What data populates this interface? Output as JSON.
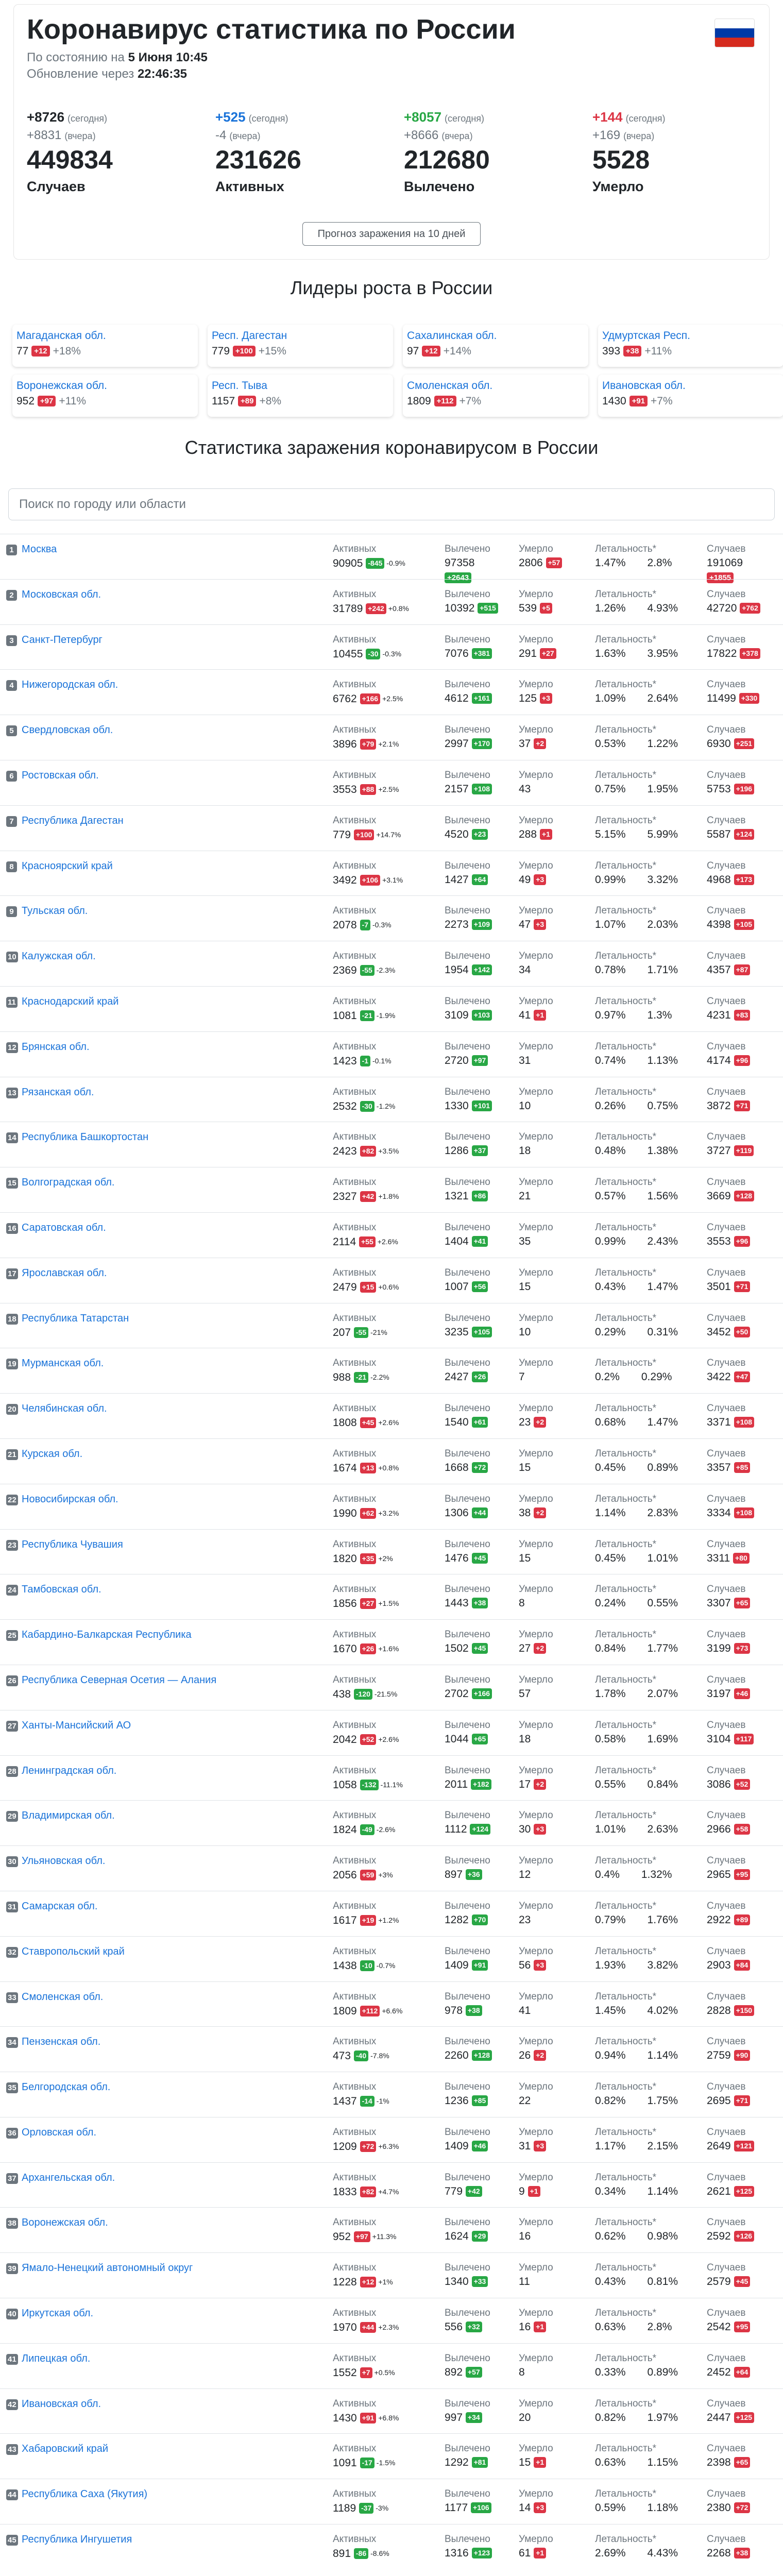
{
  "header": {
    "title": "Коронавирус статистика по России",
    "as_of_prefix": "По состоянию на",
    "as_of_value": "5 Июня 10:45",
    "update_prefix": "Обновление через",
    "update_value": "22:46:35",
    "forecast_button": "Прогноз заражения на 10 дней"
  },
  "colors": {
    "accent_blue": "#1a73d9",
    "red": "#dc3545",
    "green": "#28a745"
  },
  "summary": [
    {
      "today": "+8726",
      "today_note": "(сегодня)",
      "yesterday": "+8831",
      "yesterday_note": "(вчера)",
      "total": "449834",
      "label": "Случаев",
      "color": "#212529"
    },
    {
      "today": "+525",
      "today_note": "(сегодня)",
      "yesterday": "-4",
      "yesterday_note": "(вчера)",
      "total": "231626",
      "label": "Активных",
      "color": "#1a73d9"
    },
    {
      "today": "+8057",
      "today_note": "(сегодня)",
      "yesterday": "+8666",
      "yesterday_note": "(вчера)",
      "total": "212680",
      "label": "Вылечено",
      "color": "#28a745"
    },
    {
      "today": "+144",
      "today_note": "(сегодня)",
      "yesterday": "+169",
      "yesterday_note": "(вчера)",
      "total": "5528",
      "label": "Умерло",
      "color": "#dc3545"
    }
  ],
  "leaders_title": "Лидеры роста в России",
  "leaders": [
    {
      "name": "Магаданская обл.",
      "total": "77",
      "delta": "+12",
      "pct": "+18%"
    },
    {
      "name": "Респ. Дагестан",
      "total": "779",
      "delta": "+100",
      "pct": "+15%"
    },
    {
      "name": "Сахалинская обл.",
      "total": "97",
      "delta": "+12",
      "pct": "+14%"
    },
    {
      "name": "Удмуртская Респ.",
      "total": "393",
      "delta": "+38",
      "pct": "+11%"
    },
    {
      "name": "Воронежская обл.",
      "total": "952",
      "delta": "+97",
      "pct": "+11%"
    },
    {
      "name": "Респ. Тыва",
      "total": "1157",
      "delta": "+89",
      "pct": "+8%"
    },
    {
      "name": "Смоленская обл.",
      "total": "1809",
      "delta": "+112",
      "pct": "+7%"
    },
    {
      "name": "Ивановская обл.",
      "total": "1430",
      "delta": "+91",
      "pct": "+7%"
    }
  ],
  "stats_title": "Статистика заражения коронавирусом в России",
  "search": {
    "placeholder": "Поиск по городу или области"
  },
  "col_labels": {
    "active": "Активных",
    "recovered": "Вылечено",
    "died": "Умерло",
    "lethality": "Летальность*",
    "cases": "Случаев"
  },
  "regions": [
    {
      "n": "1",
      "name": "Москва",
      "act": "90905",
      "act_d": "-845",
      "act_p": "-0.9%",
      "rec": "97358",
      "rec_d": "+2643",
      "dea": "2806",
      "dea_d": "+57",
      "l1": "1.47%",
      "l2": "2.8%",
      "cas": "191069",
      "cas_d": "+1855"
    },
    {
      "n": "2",
      "name": "Московская обл.",
      "act": "31789",
      "act_d": "+242",
      "act_p": "+0.8%",
      "rec": "10392",
      "rec_d": "+515",
      "dea": "539",
      "dea_d": "+5",
      "l1": "1.26%",
      "l2": "4.93%",
      "cas": "42720",
      "cas_d": "+762"
    },
    {
      "n": "3",
      "name": "Санкт-Петербург",
      "act": "10455",
      "act_d": "-30",
      "act_p": "-0.3%",
      "rec": "7076",
      "rec_d": "+381",
      "dea": "291",
      "dea_d": "+27",
      "l1": "1.63%",
      "l2": "3.95%",
      "cas": "17822",
      "cas_d": "+378"
    },
    {
      "n": "4",
      "name": "Нижегородская обл.",
      "act": "6762",
      "act_d": "+166",
      "act_p": "+2.5%",
      "rec": "4612",
      "rec_d": "+161",
      "dea": "125",
      "dea_d": "+3",
      "l1": "1.09%",
      "l2": "2.64%",
      "cas": "11499",
      "cas_d": "+330"
    },
    {
      "n": "5",
      "name": "Свердловская обл.",
      "act": "3896",
      "act_d": "+79",
      "act_p": "+2.1%",
      "rec": "2997",
      "rec_d": "+170",
      "dea": "37",
      "dea_d": "+2",
      "l1": "0.53%",
      "l2": "1.22%",
      "cas": "6930",
      "cas_d": "+251"
    },
    {
      "n": "6",
      "name": "Ростовская обл.",
      "act": "3553",
      "act_d": "+88",
      "act_p": "+2.5%",
      "rec": "2157",
      "rec_d": "+108",
      "dea": "43",
      "dea_d": "",
      "l1": "0.75%",
      "l2": "1.95%",
      "cas": "5753",
      "cas_d": "+196"
    },
    {
      "n": "7",
      "name": "Республика Дагестан",
      "act": "779",
      "act_d": "+100",
      "act_p": "+14.7%",
      "rec": "4520",
      "rec_d": "+23",
      "dea": "288",
      "dea_d": "+1",
      "l1": "5.15%",
      "l2": "5.99%",
      "cas": "5587",
      "cas_d": "+124"
    },
    {
      "n": "8",
      "name": "Красноярский край",
      "act": "3492",
      "act_d": "+106",
      "act_p": "+3.1%",
      "rec": "1427",
      "rec_d": "+64",
      "dea": "49",
      "dea_d": "+3",
      "l1": "0.99%",
      "l2": "3.32%",
      "cas": "4968",
      "cas_d": "+173"
    },
    {
      "n": "9",
      "name": "Тульская обл.",
      "act": "2078",
      "act_d": "-7",
      "act_p": "-0.3%",
      "rec": "2273",
      "rec_d": "+109",
      "dea": "47",
      "dea_d": "+3",
      "l1": "1.07%",
      "l2": "2.03%",
      "cas": "4398",
      "cas_d": "+105"
    },
    {
      "n": "10",
      "name": "Калужская обл.",
      "act": "2369",
      "act_d": "-55",
      "act_p": "-2.3%",
      "rec": "1954",
      "rec_d": "+142",
      "dea": "34",
      "dea_d": "",
      "l1": "0.78%",
      "l2": "1.71%",
      "cas": "4357",
      "cas_d": "+87"
    },
    {
      "n": "11",
      "name": "Краснодарский край",
      "act": "1081",
      "act_d": "-21",
      "act_p": "-1.9%",
      "rec": "3109",
      "rec_d": "+103",
      "dea": "41",
      "dea_d": "+1",
      "l1": "0.97%",
      "l2": "1.3%",
      "cas": "4231",
      "cas_d": "+83"
    },
    {
      "n": "12",
      "name": "Брянская обл.",
      "act": "1423",
      "act_d": "-1",
      "act_p": "-0.1%",
      "rec": "2720",
      "rec_d": "+97",
      "dea": "31",
      "dea_d": "",
      "l1": "0.74%",
      "l2": "1.13%",
      "cas": "4174",
      "cas_d": "+96"
    },
    {
      "n": "13",
      "name": "Рязанская обл.",
      "act": "2532",
      "act_d": "-30",
      "act_p": "-1.2%",
      "rec": "1330",
      "rec_d": "+101",
      "dea": "10",
      "dea_d": "",
      "l1": "0.26%",
      "l2": "0.75%",
      "cas": "3872",
      "cas_d": "+71"
    },
    {
      "n": "14",
      "name": "Республика Башкортостан",
      "act": "2423",
      "act_d": "+82",
      "act_p": "+3.5%",
      "rec": "1286",
      "rec_d": "+37",
      "dea": "18",
      "dea_d": "",
      "l1": "0.48%",
      "l2": "1.38%",
      "cas": "3727",
      "cas_d": "+119"
    },
    {
      "n": "15",
      "name": "Волгоградская обл.",
      "act": "2327",
      "act_d": "+42",
      "act_p": "+1.8%",
      "rec": "1321",
      "rec_d": "+86",
      "dea": "21",
      "dea_d": "",
      "l1": "0.57%",
      "l2": "1.56%",
      "cas": "3669",
      "cas_d": "+128"
    },
    {
      "n": "16",
      "name": "Саратовская обл.",
      "act": "2114",
      "act_d": "+55",
      "act_p": "+2.6%",
      "rec": "1404",
      "rec_d": "+41",
      "dea": "35",
      "dea_d": "",
      "l1": "0.99%",
      "l2": "2.43%",
      "cas": "3553",
      "cas_d": "+96"
    },
    {
      "n": "17",
      "name": "Ярославская обл.",
      "act": "2479",
      "act_d": "+15",
      "act_p": "+0.6%",
      "rec": "1007",
      "rec_d": "+56",
      "dea": "15",
      "dea_d": "",
      "l1": "0.43%",
      "l2": "1.47%",
      "cas": "3501",
      "cas_d": "+71"
    },
    {
      "n": "18",
      "name": "Республика Татарстан",
      "act": "207",
      "act_d": "-55",
      "act_p": "-21%",
      "rec": "3235",
      "rec_d": "+105",
      "dea": "10",
      "dea_d": "",
      "l1": "0.29%",
      "l2": "0.31%",
      "cas": "3452",
      "cas_d": "+50"
    },
    {
      "n": "19",
      "name": "Мурманская обл.",
      "act": "988",
      "act_d": "-21",
      "act_p": "-2.2%",
      "rec": "2427",
      "rec_d": "+26",
      "dea": "7",
      "dea_d": "",
      "l1": "0.2%",
      "l2": "0.29%",
      "cas": "3422",
      "cas_d": "+47"
    },
    {
      "n": "20",
      "name": "Челябинская обл.",
      "act": "1808",
      "act_d": "+45",
      "act_p": "+2.6%",
      "rec": "1540",
      "rec_d": "+61",
      "dea": "23",
      "dea_d": "+2",
      "l1": "0.68%",
      "l2": "1.47%",
      "cas": "3371",
      "cas_d": "+108"
    },
    {
      "n": "21",
      "name": "Курская обл.",
      "act": "1674",
      "act_d": "+13",
      "act_p": "+0.8%",
      "rec": "1668",
      "rec_d": "+72",
      "dea": "15",
      "dea_d": "",
      "l1": "0.45%",
      "l2": "0.89%",
      "cas": "3357",
      "cas_d": "+85"
    },
    {
      "n": "22",
      "name": "Новосибирская обл.",
      "act": "1990",
      "act_d": "+62",
      "act_p": "+3.2%",
      "rec": "1306",
      "rec_d": "+44",
      "dea": "38",
      "dea_d": "+2",
      "l1": "1.14%",
      "l2": "2.83%",
      "cas": "3334",
      "cas_d": "+108"
    },
    {
      "n": "23",
      "name": "Республика Чувашия",
      "act": "1820",
      "act_d": "+35",
      "act_p": "+2%",
      "rec": "1476",
      "rec_d": "+45",
      "dea": "15",
      "dea_d": "",
      "l1": "0.45%",
      "l2": "1.01%",
      "cas": "3311",
      "cas_d": "+80"
    },
    {
      "n": "24",
      "name": "Тамбовская обл.",
      "act": "1856",
      "act_d": "+27",
      "act_p": "+1.5%",
      "rec": "1443",
      "rec_d": "+38",
      "dea": "8",
      "dea_d": "",
      "l1": "0.24%",
      "l2": "0.55%",
      "cas": "3307",
      "cas_d": "+65"
    },
    {
      "n": "25",
      "name": "Кабардино-Балкарская Республика",
      "act": "1670",
      "act_d": "+26",
      "act_p": "+1.6%",
      "rec": "1502",
      "rec_d": "+45",
      "dea": "27",
      "dea_d": "+2",
      "l1": "0.84%",
      "l2": "1.77%",
      "cas": "3199",
      "cas_d": "+73"
    },
    {
      "n": "26",
      "name": "Республика Северная Осетия — Алания",
      "act": "438",
      "act_d": "-120",
      "act_p": "-21.5%",
      "rec": "2702",
      "rec_d": "+166",
      "dea": "57",
      "dea_d": "",
      "l1": "1.78%",
      "l2": "2.07%",
      "cas": "3197",
      "cas_d": "+46"
    },
    {
      "n": "27",
      "name": "Ханты-Мансийский АО",
      "act": "2042",
      "act_d": "+52",
      "act_p": "+2.6%",
      "rec": "1044",
      "rec_d": "+65",
      "dea": "18",
      "dea_d": "",
      "l1": "0.58%",
      "l2": "1.69%",
      "cas": "3104",
      "cas_d": "+117"
    },
    {
      "n": "28",
      "name": "Ленинградская обл.",
      "act": "1058",
      "act_d": "-132",
      "act_p": "-11.1%",
      "rec": "2011",
      "rec_d": "+182",
      "dea": "17",
      "dea_d": "+2",
      "l1": "0.55%",
      "l2": "0.84%",
      "cas": "3086",
      "cas_d": "+52"
    },
    {
      "n": "29",
      "name": "Владимирская обл.",
      "act": "1824",
      "act_d": "-49",
      "act_p": "-2.6%",
      "rec": "1112",
      "rec_d": "+124",
      "dea": "30",
      "dea_d": "+3",
      "l1": "1.01%",
      "l2": "2.63%",
      "cas": "2966",
      "cas_d": "+58"
    },
    {
      "n": "30",
      "name": "Ульяновская обл.",
      "act": "2056",
      "act_d": "+59",
      "act_p": "+3%",
      "rec": "897",
      "rec_d": "+36",
      "dea": "12",
      "dea_d": "",
      "l1": "0.4%",
      "l2": "1.32%",
      "cas": "2965",
      "cas_d": "+95"
    },
    {
      "n": "31",
      "name": "Самарская обл.",
      "act": "1617",
      "act_d": "+19",
      "act_p": "+1.2%",
      "rec": "1282",
      "rec_d": "+70",
      "dea": "23",
      "dea_d": "",
      "l1": "0.79%",
      "l2": "1.76%",
      "cas": "2922",
      "cas_d": "+89"
    },
    {
      "n": "32",
      "name": "Ставропольский край",
      "act": "1438",
      "act_d": "-10",
      "act_p": "-0.7%",
      "rec": "1409",
      "rec_d": "+91",
      "dea": "56",
      "dea_d": "+3",
      "l1": "1.93%",
      "l2": "3.82%",
      "cas": "2903",
      "cas_d": "+84"
    },
    {
      "n": "33",
      "name": "Смоленская обл.",
      "act": "1809",
      "act_d": "+112",
      "act_p": "+6.6%",
      "rec": "978",
      "rec_d": "+38",
      "dea": "41",
      "dea_d": "",
      "l1": "1.45%",
      "l2": "4.02%",
      "cas": "2828",
      "cas_d": "+150"
    },
    {
      "n": "34",
      "name": "Пензенская обл.",
      "act": "473",
      "act_d": "-40",
      "act_p": "-7.8%",
      "rec": "2260",
      "rec_d": "+128",
      "dea": "26",
      "dea_d": "+2",
      "l1": "0.94%",
      "l2": "1.14%",
      "cas": "2759",
      "cas_d": "+90"
    },
    {
      "n": "35",
      "name": "Белгородская обл.",
      "act": "1437",
      "act_d": "-14",
      "act_p": "-1%",
      "rec": "1236",
      "rec_d": "+85",
      "dea": "22",
      "dea_d": "",
      "l1": "0.82%",
      "l2": "1.75%",
      "cas": "2695",
      "cas_d": "+71"
    },
    {
      "n": "36",
      "name": "Орловская обл.",
      "act": "1209",
      "act_d": "+72",
      "act_p": "+6.3%",
      "rec": "1409",
      "rec_d": "+46",
      "dea": "31",
      "dea_d": "+3",
      "l1": "1.17%",
      "l2": "2.15%",
      "cas": "2649",
      "cas_d": "+121"
    },
    {
      "n": "37",
      "name": "Архангельская обл.",
      "act": "1833",
      "act_d": "+82",
      "act_p": "+4.7%",
      "rec": "779",
      "rec_d": "+42",
      "dea": "9",
      "dea_d": "+1",
      "l1": "0.34%",
      "l2": "1.14%",
      "cas": "2621",
      "cas_d": "+125"
    },
    {
      "n": "38",
      "name": "Воронежская обл.",
      "act": "952",
      "act_d": "+97",
      "act_p": "+11.3%",
      "rec": "1624",
      "rec_d": "+29",
      "dea": "16",
      "dea_d": "",
      "l1": "0.62%",
      "l2": "0.98%",
      "cas": "2592",
      "cas_d": "+126"
    },
    {
      "n": "39",
      "name": "Ямало-Ненецкий автономный округ",
      "act": "1228",
      "act_d": "+12",
      "act_p": "+1%",
      "rec": "1340",
      "rec_d": "+33",
      "dea": "11",
      "dea_d": "",
      "l1": "0.43%",
      "l2": "0.81%",
      "cas": "2579",
      "cas_d": "+45"
    },
    {
      "n": "40",
      "name": "Иркутская обл.",
      "act": "1970",
      "act_d": "+44",
      "act_p": "+2.3%",
      "rec": "556",
      "rec_d": "+32",
      "dea": "16",
      "dea_d": "+1",
      "l1": "0.63%",
      "l2": "2.8%",
      "cas": "2542",
      "cas_d": "+95"
    },
    {
      "n": "41",
      "name": "Липецкая обл.",
      "act": "1552",
      "act_d": "+7",
      "act_p": "+0.5%",
      "rec": "892",
      "rec_d": "+57",
      "dea": "8",
      "dea_d": "",
      "l1": "0.33%",
      "l2": "0.89%",
      "cas": "2452",
      "cas_d": "+64"
    },
    {
      "n": "42",
      "name": "Ивановская обл.",
      "act": "1430",
      "act_d": "+91",
      "act_p": "+6.8%",
      "rec": "997",
      "rec_d": "+34",
      "dea": "20",
      "dea_d": "",
      "l1": "0.82%",
      "l2": "1.97%",
      "cas": "2447",
      "cas_d": "+125"
    },
    {
      "n": "43",
      "name": "Хабаровский край",
      "act": "1091",
      "act_d": "-17",
      "act_p": "-1.5%",
      "rec": "1292",
      "rec_d": "+81",
      "dea": "15",
      "dea_d": "+1",
      "l1": "0.63%",
      "l2": "1.15%",
      "cas": "2398",
      "cas_d": "+65"
    },
    {
      "n": "44",
      "name": "Республика Саха (Якутия)",
      "act": "1189",
      "act_d": "-37",
      "act_p": "-3%",
      "rec": "1177",
      "rec_d": "+106",
      "dea": "14",
      "dea_d": "+3",
      "l1": "0.59%",
      "l2": "1.18%",
      "cas": "2380",
      "cas_d": "+72"
    },
    {
      "n": "45",
      "name": "Республика Ингушетия",
      "act": "891",
      "act_d": "-86",
      "act_p": "-8.6%",
      "rec": "1316",
      "rec_d": "+123",
      "dea": "61",
      "dea_d": "+1",
      "l1": "2.69%",
      "l2": "4.43%",
      "cas": "2268",
      "cas_d": "+38"
    }
  ]
}
